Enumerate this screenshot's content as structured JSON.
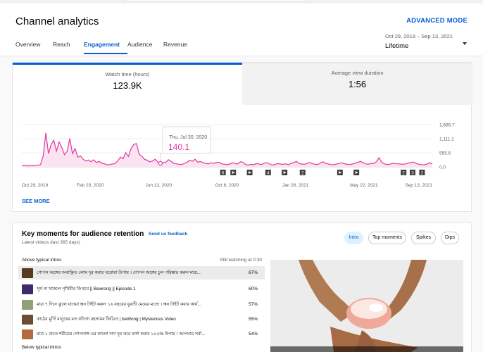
{
  "header": {
    "title": "Channel analytics",
    "advanced_mode": "ADVANCED MODE",
    "tabs": [
      {
        "label": "Overview",
        "active": false
      },
      {
        "label": "Reach",
        "active": false
      },
      {
        "label": "Engagement",
        "active": true
      },
      {
        "label": "Audience",
        "active": false
      },
      {
        "label": "Revenue",
        "active": false
      }
    ],
    "date_range": "Oct 29, 2019 – Sep 13, 2021",
    "range_label": "Lifetime"
  },
  "metrics": [
    {
      "label": "Watch time (hours)",
      "value": "123.9K"
    },
    {
      "label": "Average view duration",
      "value": "1:56"
    }
  ],
  "tooltip": {
    "date": "Thu, Jul 30, 2020",
    "value": "140.1"
  },
  "see_more": "SEE MORE",
  "chart_data": {
    "type": "area",
    "series": [
      {
        "values": [
          40,
          60,
          38,
          42,
          52,
          48,
          60,
          90,
          420,
          1340,
          520,
          880,
          1050,
          620,
          980,
          760,
          480,
          610,
          1120,
          520,
          720,
          380,
          430,
          300,
          230,
          270,
          200,
          280,
          170,
          220,
          140,
          120,
          80,
          90,
          110,
          130,
          240,
          380,
          320,
          560,
          410,
          720,
          880,
          920,
          500,
          420,
          300,
          260,
          200,
          230,
          300,
          190,
          140,
          160,
          180,
          280,
          220,
          140,
          120,
          100,
          90,
          140,
          180,
          260,
          220,
          300,
          180,
          210,
          160,
          140,
          120,
          160,
          140,
          170,
          180,
          120,
          100,
          90,
          110,
          160,
          130,
          110,
          200,
          180,
          90,
          70,
          100,
          80,
          130,
          110,
          90,
          150,
          160,
          110,
          70,
          90,
          130,
          110,
          100,
          120,
          80,
          140,
          160,
          220,
          130,
          110,
          100,
          140,
          170,
          130,
          100,
          90,
          150,
          200,
          140,
          110,
          90,
          80,
          110,
          130,
          160,
          120,
          100,
          90,
          110,
          140,
          170,
          220,
          160,
          120,
          100,
          140,
          130,
          200,
          360,
          180,
          120,
          90,
          100,
          140,
          130,
          120,
          110,
          100,
          120,
          150,
          170,
          190,
          130,
          100,
          90,
          80,
          110,
          160,
          120
        ]
      }
    ],
    "x_tick_labels": [
      "Oct 29, 2019",
      "Feb 20, 2020",
      "Jun 13, 2020",
      "Oct 6, 2020",
      "Jan 28, 2021",
      "May 22, 2021",
      "Sep 13, 2021"
    ],
    "y_tick_labels": [
      "1,666.7",
      "1,111.1",
      "555.6",
      "0.0"
    ],
    "ylim": [
      0,
      1666.7
    ],
    "markers": [
      {
        "kind": "num",
        "text": "6",
        "pos": 0.49
      },
      {
        "kind": "play",
        "text": "",
        "pos": 0.515
      },
      {
        "kind": "play",
        "text": "",
        "pos": 0.555
      },
      {
        "kind": "num",
        "text": "4",
        "pos": 0.6
      },
      {
        "kind": "play",
        "text": "",
        "pos": 0.64
      },
      {
        "kind": "num",
        "text": "2",
        "pos": 0.684
      },
      {
        "kind": "play",
        "text": "",
        "pos": 0.775
      },
      {
        "kind": "play",
        "text": "",
        "pos": 0.815
      },
      {
        "kind": "num",
        "text": "2",
        "pos": 0.93
      },
      {
        "kind": "num",
        "text": "3",
        "pos": 0.952
      },
      {
        "kind": "num",
        "text": "2",
        "pos": 0.975
      }
    ],
    "tooltip_point_index": 52,
    "colors": {
      "line": "#e2389f",
      "fill": "#fbe3f1"
    }
  },
  "key_moments": {
    "title": "Key moments for audience retention",
    "feedback": "Send us feedback",
    "subtitle": "Latest videos (last 365 days)",
    "chips": [
      {
        "label": "Intro",
        "active": true
      },
      {
        "label": "Top moments",
        "active": false
      },
      {
        "label": "Spikes",
        "active": false
      },
      {
        "label": "Dips",
        "active": false
      }
    ],
    "above_label": "Above typical intros",
    "still_watching": "Still watching at 0:30",
    "rows": [
      {
        "title": "গোপন অঙ্গের অবাঞ্ছিত লোম দূর করার ঘরোয়া উপায় । গোপন অঙ্গের চুল পরিষ্কার করুন মাত্র...",
        "pct": "67%",
        "thumb": "#5a3a1e",
        "highlight": true
      },
      {
        "title": "সূর্য না থাকলে পৃথিবীর কি হবে || Bewrong || Episode 1",
        "pct": "60%",
        "thumb": "#3d2b6b",
        "highlight": false
      },
      {
        "title": "মাত্র ৭ দিনে ঝুলে যাওয়া স্তন টাইট করুন ১৬ বছরের যুবতী মেয়ের মতো । স্তন টাইট করার কার্য...",
        "pct": "57%",
        "thumb": "#8fa07a",
        "highlight": false
      },
      {
        "title": "কাঠের মূর্তি মানুষের মত কাঁদে!! রহস্যময় ভিডিও | beWong | Mysterious Video",
        "pct": "55%",
        "thumb": "#6b4e32",
        "highlight": false
      },
      {
        "title": "মাত্র ১ রাতে শরীরের গোপনাঙ্গ এর কালো দাগ দূর করে ফর্সা করার ১০০% উপায় । আপনার সর্বা...",
        "pct": "54%",
        "thumb": "#b56a3c",
        "highlight": false
      }
    ],
    "below_label": "Below typical intros"
  }
}
